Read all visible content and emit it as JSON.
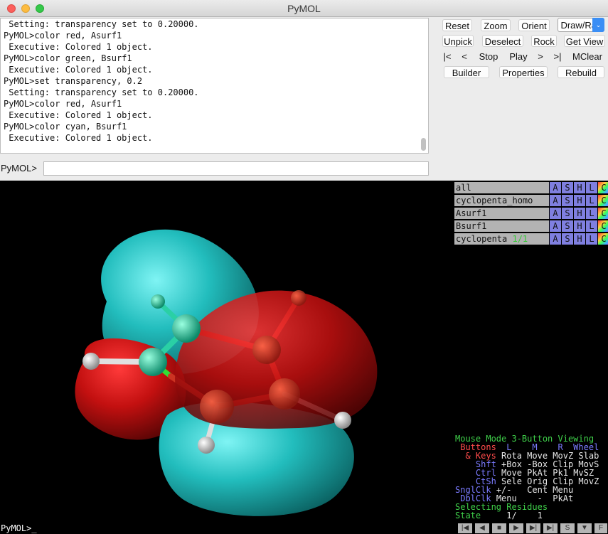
{
  "window": {
    "title": "PyMOL"
  },
  "console": {
    "lines": [
      " Setting: transparency set to 0.20000.",
      "PyMOL>color red, Asurf1",
      " Executive: Colored 1 object.",
      "PyMOL>color green, Bsurf1",
      " Executive: Colored 1 object.",
      "PyMOL>set transparency, 0.2",
      " Setting: transparency set to 0.20000.",
      "PyMOL>color red, Asurf1",
      " Executive: Colored 1 object.",
      "PyMOL>color cyan, Bsurf1",
      " Executive: Colored 1 object."
    ]
  },
  "command": {
    "prompt": "PyMOL>",
    "value": ""
  },
  "buttons": {
    "reset": "Reset",
    "zoom": "Zoom",
    "orient": "Orient",
    "draw_ray": "Draw/Ray",
    "unpick": "Unpick",
    "deselect": "Deselect",
    "rock": "Rock",
    "get_view": "Get View",
    "first": "|<",
    "prev": "<",
    "stop": "Stop",
    "play": "Play",
    "next": ">",
    "last": ">|",
    "mclear": "MClear",
    "builder": "Builder",
    "properties": "Properties",
    "rebuild": "Rebuild"
  },
  "objects": [
    {
      "name": "all",
      "state": ""
    },
    {
      "name": "cyclopenta_homo",
      "state": ""
    },
    {
      "name": "Asurf1",
      "state": ""
    },
    {
      "name": "Bsurf1",
      "state": ""
    },
    {
      "name": "cyclopenta",
      "state": "1/1"
    }
  ],
  "object_buttons": [
    "A",
    "S",
    "H",
    "L",
    "C"
  ],
  "mouse": {
    "title": "Mouse Mode 3-Button Viewing",
    "buttons_label": "Buttons",
    "cols": [
      "L",
      "M",
      "R",
      "Wheel"
    ],
    "keys_label": "& Keys",
    "rows": [
      {
        "key": "",
        "vals": [
          "Rota",
          "Move",
          "MovZ",
          "Slab"
        ]
      },
      {
        "key": "Shft",
        "vals": [
          "+Box",
          "-Box",
          "Clip",
          "MovS"
        ]
      },
      {
        "key": "Ctrl",
        "vals": [
          "Move",
          "PkAt",
          "Pk1",
          "MvSZ"
        ]
      },
      {
        "key": "CtSh",
        "vals": [
          "Sele",
          "Orig",
          "Clip",
          "MovZ"
        ]
      }
    ],
    "sngl_label": "SnglClk",
    "sngl_vals": "+/-   Cent Menu",
    "dbl_label": "DblClk",
    "dbl_vals": "Menu    -  PkAt",
    "selecting": "Selecting Residues",
    "state_label": "State",
    "state_val": "1/",
    "state_total": "1"
  },
  "bottom_prompt": "PyMOL>_",
  "colors": {
    "lobe_cyan": "#1fbcbc",
    "lobe_red": "#c41010",
    "background": "#000000"
  }
}
